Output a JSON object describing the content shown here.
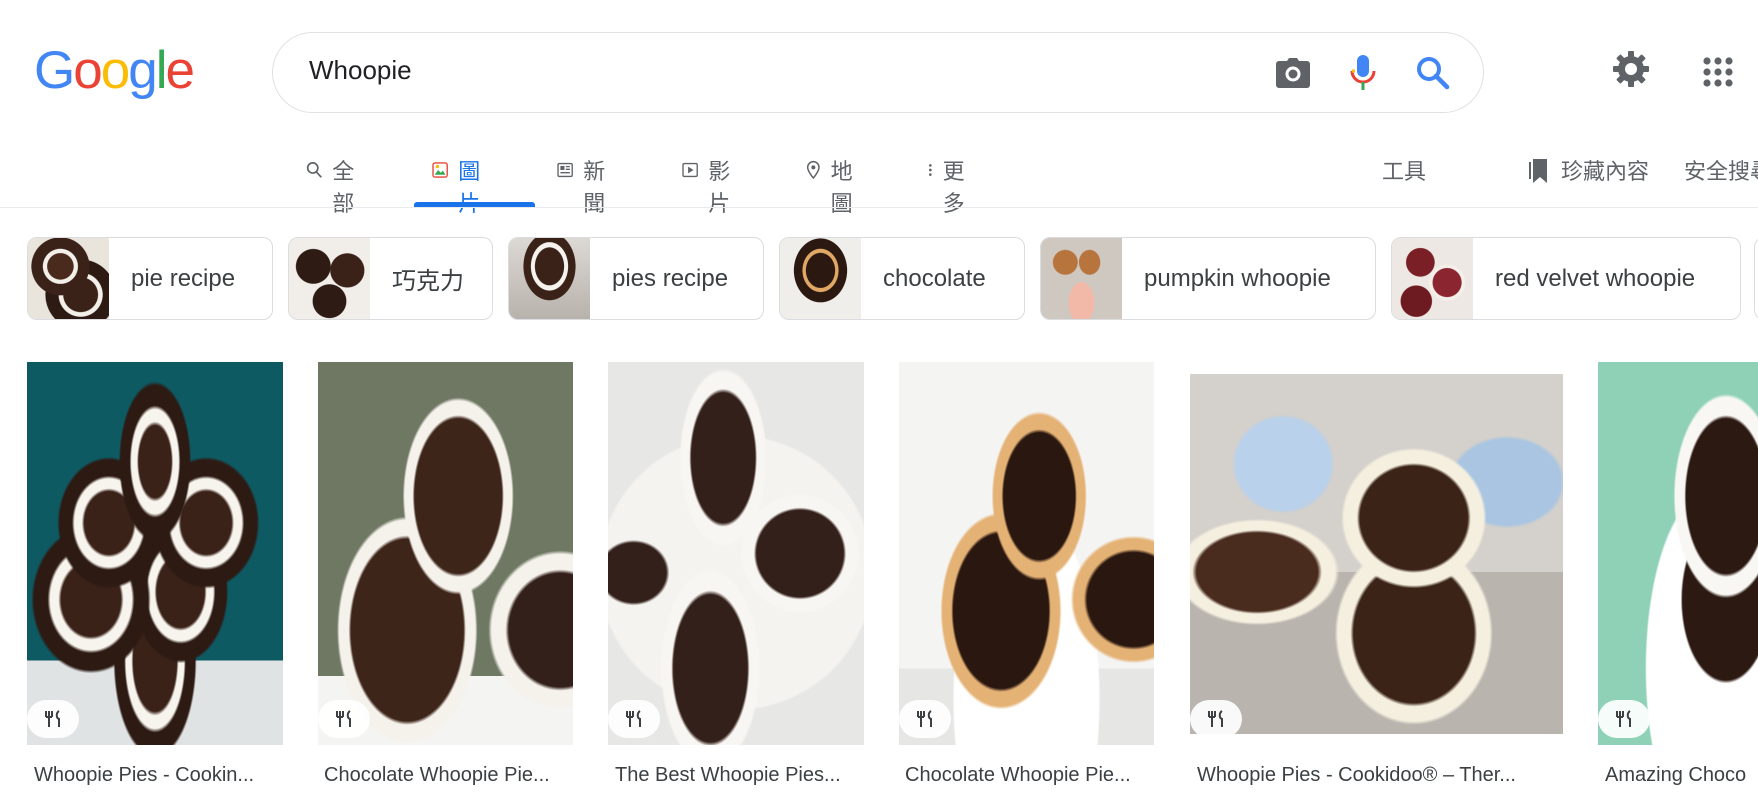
{
  "logo": {
    "letters": [
      "G",
      "o",
      "o",
      "g",
      "l",
      "e"
    ],
    "colors": [
      "#4285f4",
      "#ea4335",
      "#fbbc05",
      "#4285f4",
      "#34a853",
      "#ea4335"
    ]
  },
  "search": {
    "query": "Whoopie",
    "icons": [
      "camera-icon",
      "microphone-icon",
      "search-icon"
    ]
  },
  "header_right": {
    "icons": [
      "settings-gear-icon",
      "apps-grid-icon"
    ]
  },
  "tabs": [
    {
      "label": "全部",
      "icon": "search-icon",
      "active": false
    },
    {
      "label": "圖片",
      "icon": "image-icon",
      "active": true
    },
    {
      "label": "新聞",
      "icon": "news-icon",
      "active": false
    },
    {
      "label": "影片",
      "icon": "video-icon",
      "active": false
    },
    {
      "label": "地圖",
      "icon": "map-pin-icon",
      "active": false
    },
    {
      "label": "更多",
      "icon": "more-vertical-icon",
      "active": false
    }
  ],
  "toolbar": {
    "tools": "工具",
    "saved": "珍藏內容",
    "safe_search": "安全搜尋"
  },
  "chips": [
    {
      "label": "pie recipe"
    },
    {
      "label": "巧克力"
    },
    {
      "label": "pies recipe"
    },
    {
      "label": "chocolate"
    },
    {
      "label": "pumpkin whoopie"
    },
    {
      "label": "red velvet whoopie"
    }
  ],
  "results": [
    {
      "title": "Whoopie Pies - Cookin...",
      "bg": "#0e5a63",
      "badge_icon": "recipe-utensils-icon"
    },
    {
      "title": "Chocolate Whoopie Pie...",
      "bg": "#6f7863",
      "badge_icon": "recipe-utensils-icon"
    },
    {
      "title": "The Best Whoopie Pies...",
      "bg": "#e7e7e5",
      "badge_icon": "recipe-utensils-icon"
    },
    {
      "title": "Chocolate Whoopie Pie...",
      "bg": "#f1f1f0",
      "badge_icon": "recipe-utensils-icon"
    },
    {
      "title": "Whoopie Pies - Cookidoo® – Ther...",
      "bg": "#c9c6c2",
      "badge_icon": "recipe-utensils-icon"
    },
    {
      "title": "Amazing Choco",
      "bg": "#8fd1b6",
      "badge_icon": "recipe-utensils-icon"
    }
  ],
  "colors": {
    "accent": "#1a73e8",
    "text": "#202124",
    "muted": "#5f6368",
    "border": "#dadce0"
  }
}
